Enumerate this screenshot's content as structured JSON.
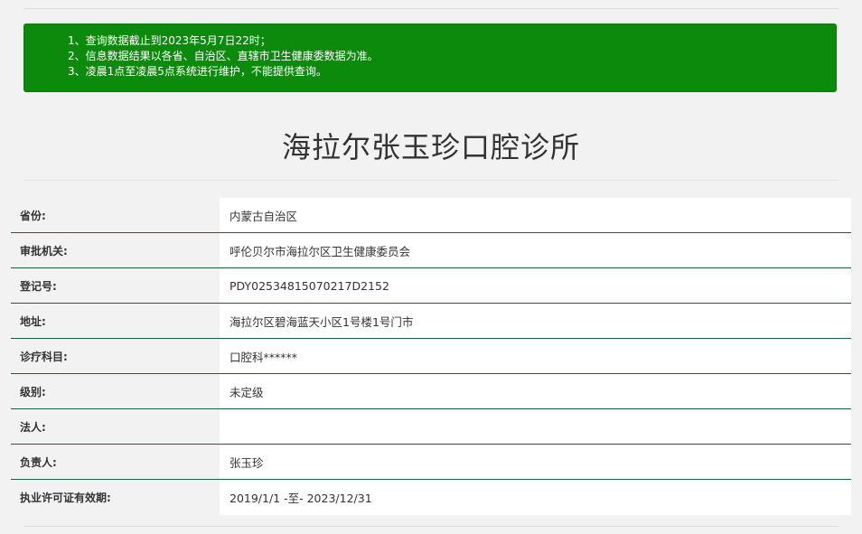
{
  "notice": {
    "lines": [
      "1、查询数据截止到2023年5月7日22时；",
      "2、信息数据结果以各省、自治区、直辖市卫生健康委数据为准。",
      "3、凌晨1点至凌晨5点系统进行维护，不能提供查询。"
    ],
    "background_color": "#0c8a0c"
  },
  "title": "海拉尔张玉珍口腔诊所",
  "table": {
    "row_border_color": "#1f5e36",
    "rows": [
      {
        "label": "省份:",
        "value": "内蒙古自治区"
      },
      {
        "label": "审批机关:",
        "value": "呼伦贝尔市海拉尔区卫生健康委员会"
      },
      {
        "label": "登记号:",
        "value": "PDY02534815070217D2152"
      },
      {
        "label": "地址:",
        "value": "海拉尔区碧海蓝天小区1号楼1号门市"
      },
      {
        "label": "诊疗科目:",
        "value": "口腔科******"
      },
      {
        "label": "级别:",
        "value": "未定级"
      },
      {
        "label": "法人:",
        "value": ""
      },
      {
        "label": "负责人:",
        "value": "张玉珍"
      },
      {
        "label": "执业许可证有效期:",
        "value": "2019/1/1 -至- 2023/12/31"
      }
    ]
  }
}
